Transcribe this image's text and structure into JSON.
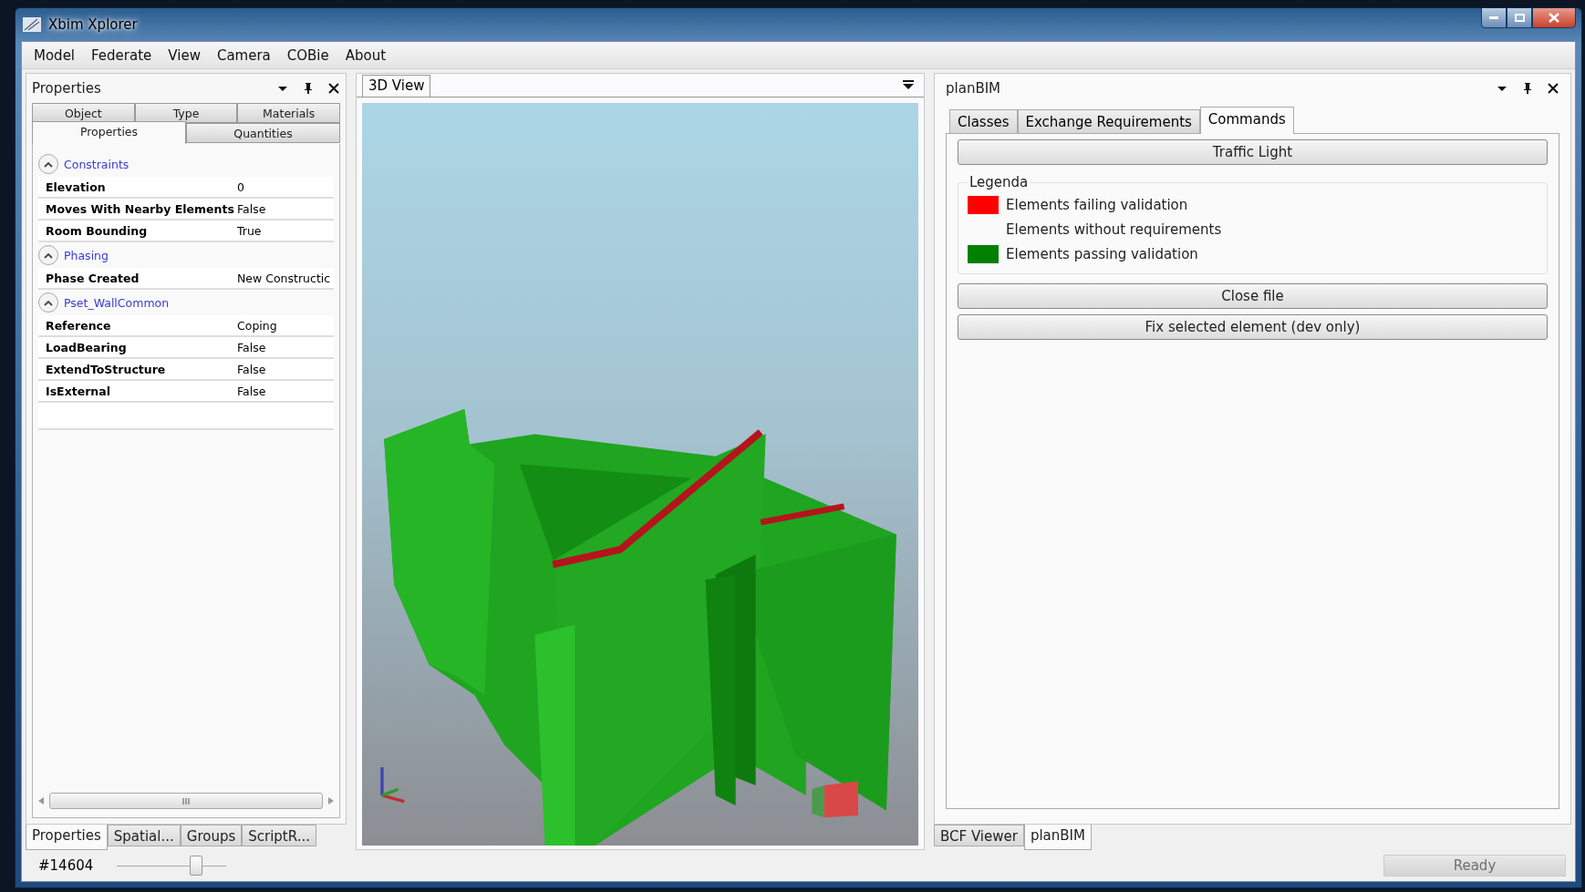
{
  "window": {
    "title": "Xbim Xplorer"
  },
  "menu": [
    "Model",
    "Federate",
    "View",
    "Camera",
    "COBie",
    "About"
  ],
  "properties_panel": {
    "title": "Properties",
    "tabs_row_1": [
      {
        "label": "Object",
        "selected": false
      },
      {
        "label": "Type",
        "selected": false
      },
      {
        "label": "Materials",
        "selected": false
      }
    ],
    "tabs_row_2": [
      {
        "label": "Properties",
        "selected": true
      },
      {
        "label": "Quantities",
        "selected": false
      }
    ],
    "groups": [
      {
        "name": "Constraints",
        "expanded": true,
        "rows": [
          {
            "name": "Elevation",
            "value": "0"
          },
          {
            "name": "Moves With Nearby Elements",
            "value": "False"
          },
          {
            "name": "Room Bounding",
            "value": "True"
          }
        ]
      },
      {
        "name": "Phasing",
        "expanded": true,
        "rows": [
          {
            "name": "Phase Created",
            "value": "New Constructic"
          }
        ]
      },
      {
        "name": "Pset_WallCommon",
        "expanded": true,
        "rows": [
          {
            "name": "Reference",
            "value": "Coping"
          },
          {
            "name": "LoadBearing",
            "value": "False"
          },
          {
            "name": "ExtendToStructure",
            "value": "False"
          },
          {
            "name": "IsExternal",
            "value": "False"
          }
        ]
      }
    ],
    "bottom_tabs": [
      {
        "label": "Properties",
        "selected": true
      },
      {
        "label": "Spatial...",
        "selected": false
      },
      {
        "label": "Groups",
        "selected": false
      },
      {
        "label": "ScriptR...",
        "selected": false
      }
    ]
  },
  "view_panel": {
    "tab": "3D View"
  },
  "planbim_panel": {
    "title": "planBIM",
    "tabs": [
      {
        "label": "Classes",
        "selected": false
      },
      {
        "label": "Exchange Requirements",
        "selected": false
      },
      {
        "label": "Commands",
        "selected": true
      }
    ],
    "traffic_button": "Traffic Light",
    "legend": {
      "title": "Legenda",
      "items": [
        {
          "label": "Elements failing validation",
          "color": "#ff0000"
        },
        {
          "label": "Elements without requirements"
        },
        {
          "label": "Elements passing validation",
          "color": "#008000"
        }
      ]
    },
    "buttons": [
      "Close file",
      "Fix selected element (dev only)"
    ],
    "bottom_tabs": [
      {
        "label": "BCF Viewer",
        "selected": false
      },
      {
        "label": "planBIM",
        "selected": true
      }
    ]
  },
  "status_bar": {
    "selection": "#14604",
    "slider": {
      "level": 0.72
    },
    "status": {
      "label": "Ready",
      "disabled": true
    }
  }
}
